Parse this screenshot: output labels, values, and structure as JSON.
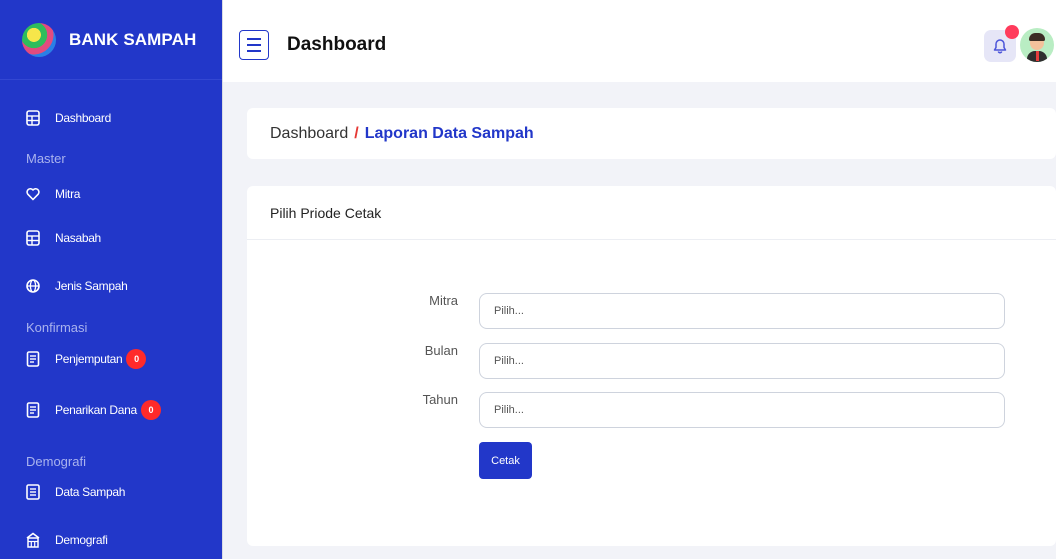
{
  "brand": {
    "name": "BANK SAMPAH"
  },
  "header": {
    "title": "Dashboard"
  },
  "sidebar": {
    "items": [
      {
        "label": "Dashboard",
        "icon": "table-icon"
      },
      {
        "section": "Master"
      },
      {
        "label": "Mitra",
        "icon": "heart-icon"
      },
      {
        "label": "Nasabah",
        "icon": "table-icon"
      },
      {
        "label": "Jenis Sampah",
        "icon": "globe-icon"
      },
      {
        "section": "Konfirmasi"
      },
      {
        "label": "Penjemputan",
        "icon": "document-icon",
        "badge": "0"
      },
      {
        "label": "Penarikan Dana",
        "icon": "document-icon",
        "badge": "0"
      },
      {
        "section": "Demografi"
      },
      {
        "label": "Data Sampah",
        "icon": "list-icon"
      },
      {
        "label": "Demografi",
        "icon": "building-icon"
      }
    ]
  },
  "breadcrumb": {
    "home": "Dashboard",
    "separator": "/",
    "current": "Laporan Data Sampah"
  },
  "form": {
    "title": "Pilih Priode Cetak",
    "fields": [
      {
        "label": "Mitra",
        "placeholder": "Pilih..."
      },
      {
        "label": "Bulan",
        "placeholder": "Pilih..."
      },
      {
        "label": "Tahun",
        "placeholder": "Pilih..."
      }
    ],
    "submit_label": "Cetak"
  },
  "colors": {
    "primary": "#2237c9",
    "badge": "#ff2a2a",
    "breadcrumb_separator": "#e53935",
    "background": "#f2f3f8"
  }
}
